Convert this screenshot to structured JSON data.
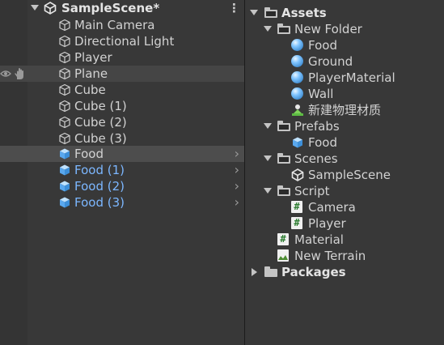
{
  "hierarchy": {
    "scene_name": "SampleScene*",
    "menu_glyph": "⋮",
    "items": [
      {
        "label": "Main Camera",
        "prefab": false
      },
      {
        "label": "Directional Light",
        "prefab": false
      },
      {
        "label": "Player",
        "prefab": false
      },
      {
        "label": "Plane",
        "prefab": false
      },
      {
        "label": "Cube",
        "prefab": false
      },
      {
        "label": "Cube (1)",
        "prefab": false
      },
      {
        "label": "Cube (2)",
        "prefab": false
      },
      {
        "label": "Cube (3)",
        "prefab": false
      },
      {
        "label": "Food",
        "prefab": true
      },
      {
        "label": "Food (1)",
        "prefab": true
      },
      {
        "label": "Food (2)",
        "prefab": true
      },
      {
        "label": "Food (3)",
        "prefab": true
      }
    ],
    "expand_glyph": "›"
  },
  "project": {
    "assets_label": "Assets",
    "new_folder_label": "New Folder",
    "new_folder_items": [
      "Food",
      "Ground",
      "PlayerMaterial",
      "Wall",
      "新建物理材质"
    ],
    "prefabs_label": "Prefabs",
    "prefabs_items": [
      "Food"
    ],
    "scenes_label": "Scenes",
    "scenes_items": [
      "SampleScene"
    ],
    "script_label": "Script",
    "script_items": [
      "Camera",
      "Player"
    ],
    "material_label": "Material",
    "terrain_label": "New Terrain",
    "packages_label": "Packages",
    "script_glyph": "#"
  },
  "colors": {
    "panel_bg": "#383838",
    "gutter_bg": "#343434",
    "hover_row": "#454545",
    "selected_row": "#4d4d4d",
    "text": "#d2d2d2",
    "prefab_text": "#7cb7ff"
  },
  "icons": {
    "gameobject": "cube-outline-icon",
    "prefab": "blue-cube-icon",
    "scene": "unity-logo-icon",
    "material": "sphere-icon",
    "script": "cs-script-icon",
    "physics_material": "physics-material-icon",
    "terrain": "terrain-icon",
    "folder": "folder-icon",
    "visibility": "eye-icon",
    "pickable": "hand-icon"
  }
}
